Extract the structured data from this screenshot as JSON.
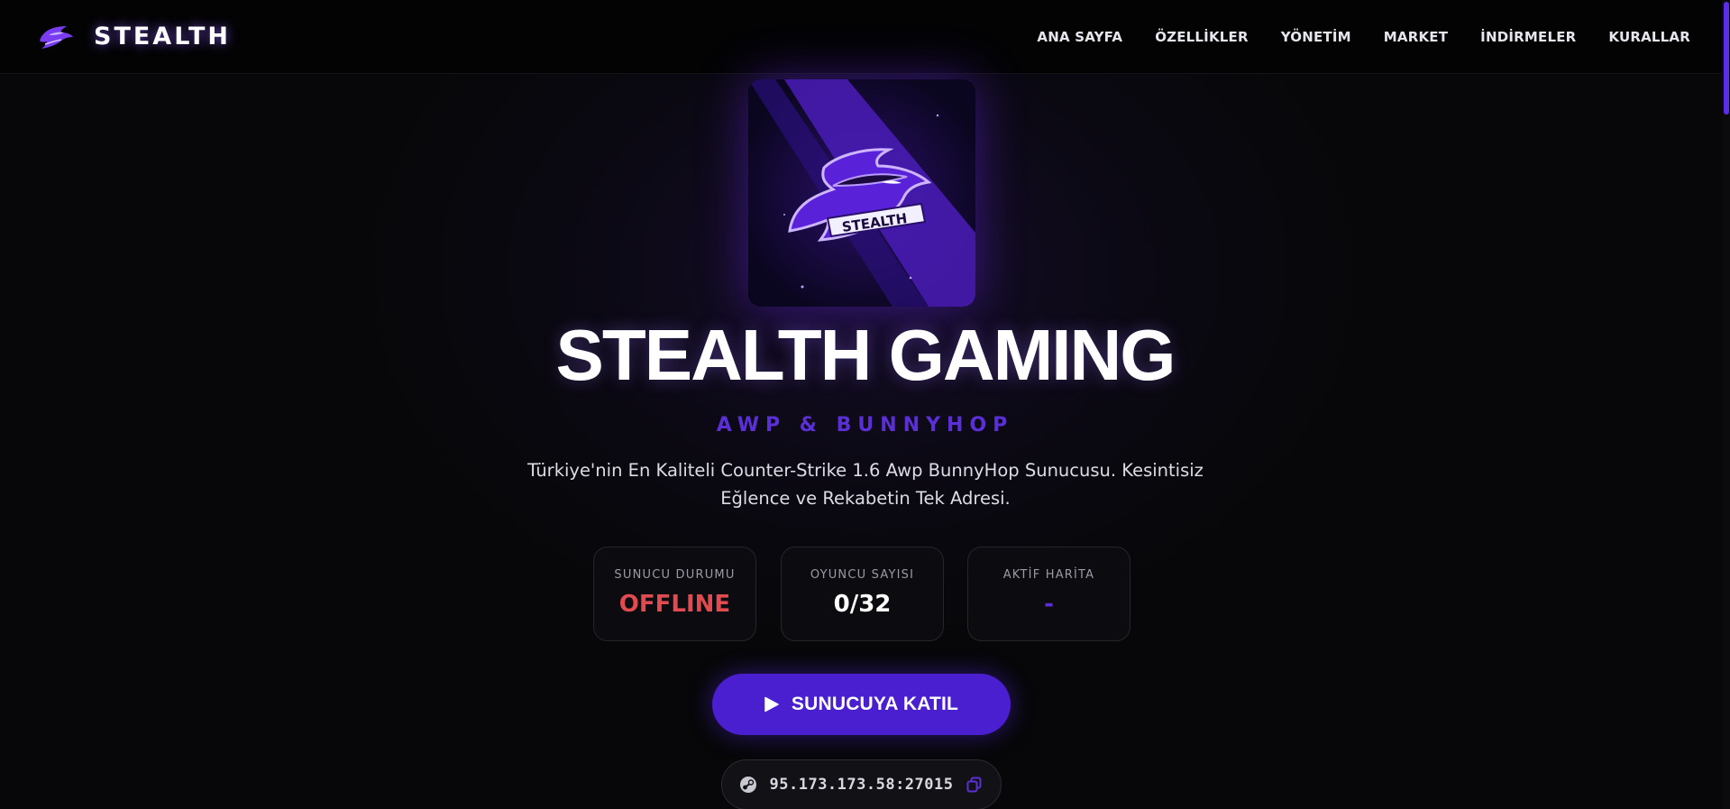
{
  "brand": {
    "name": "STEALTH",
    "logo_icon": "stealth-mask-icon"
  },
  "nav": {
    "items": [
      {
        "label": "ANA SAYFA"
      },
      {
        "label": "ÖZELLİKLER"
      },
      {
        "label": "YÖNETİM"
      },
      {
        "label": "MARKET"
      },
      {
        "label": "İNDİRMELER"
      },
      {
        "label": "KURALLAR"
      }
    ]
  },
  "hero": {
    "logo_text": "STEALTH",
    "title": "STEALTH GAMING",
    "subtitle": "AWP & BUNNYHOP",
    "description": "Türkiye'nin En Kaliteli Counter-Strike 1.6 Awp BunnyHop Sunucusu. Kesintisiz Eğlence ve Rekabetin Tek Adresi."
  },
  "stats": [
    {
      "label": "SUNUCU DURUMU",
      "value": "OFFLINE",
      "color": "#e14a4f"
    },
    {
      "label": "OYUNCU SAYISI",
      "value": "0/32",
      "color": "#ffffff"
    },
    {
      "label": "AKTİF HARİTA",
      "value": "-",
      "color": "#5b2fd6"
    }
  ],
  "cta": {
    "join_label": "SUNUCUYA KATIL",
    "icon": "play-icon"
  },
  "server": {
    "ip": "95.173.173.58:27015",
    "icon": "steam-icon",
    "copy_icon": "copy-icon"
  },
  "colors": {
    "accent": "#4a1fd0",
    "accent_text": "#5b2fd6",
    "background": "#070709",
    "offline": "#e14a4f"
  }
}
